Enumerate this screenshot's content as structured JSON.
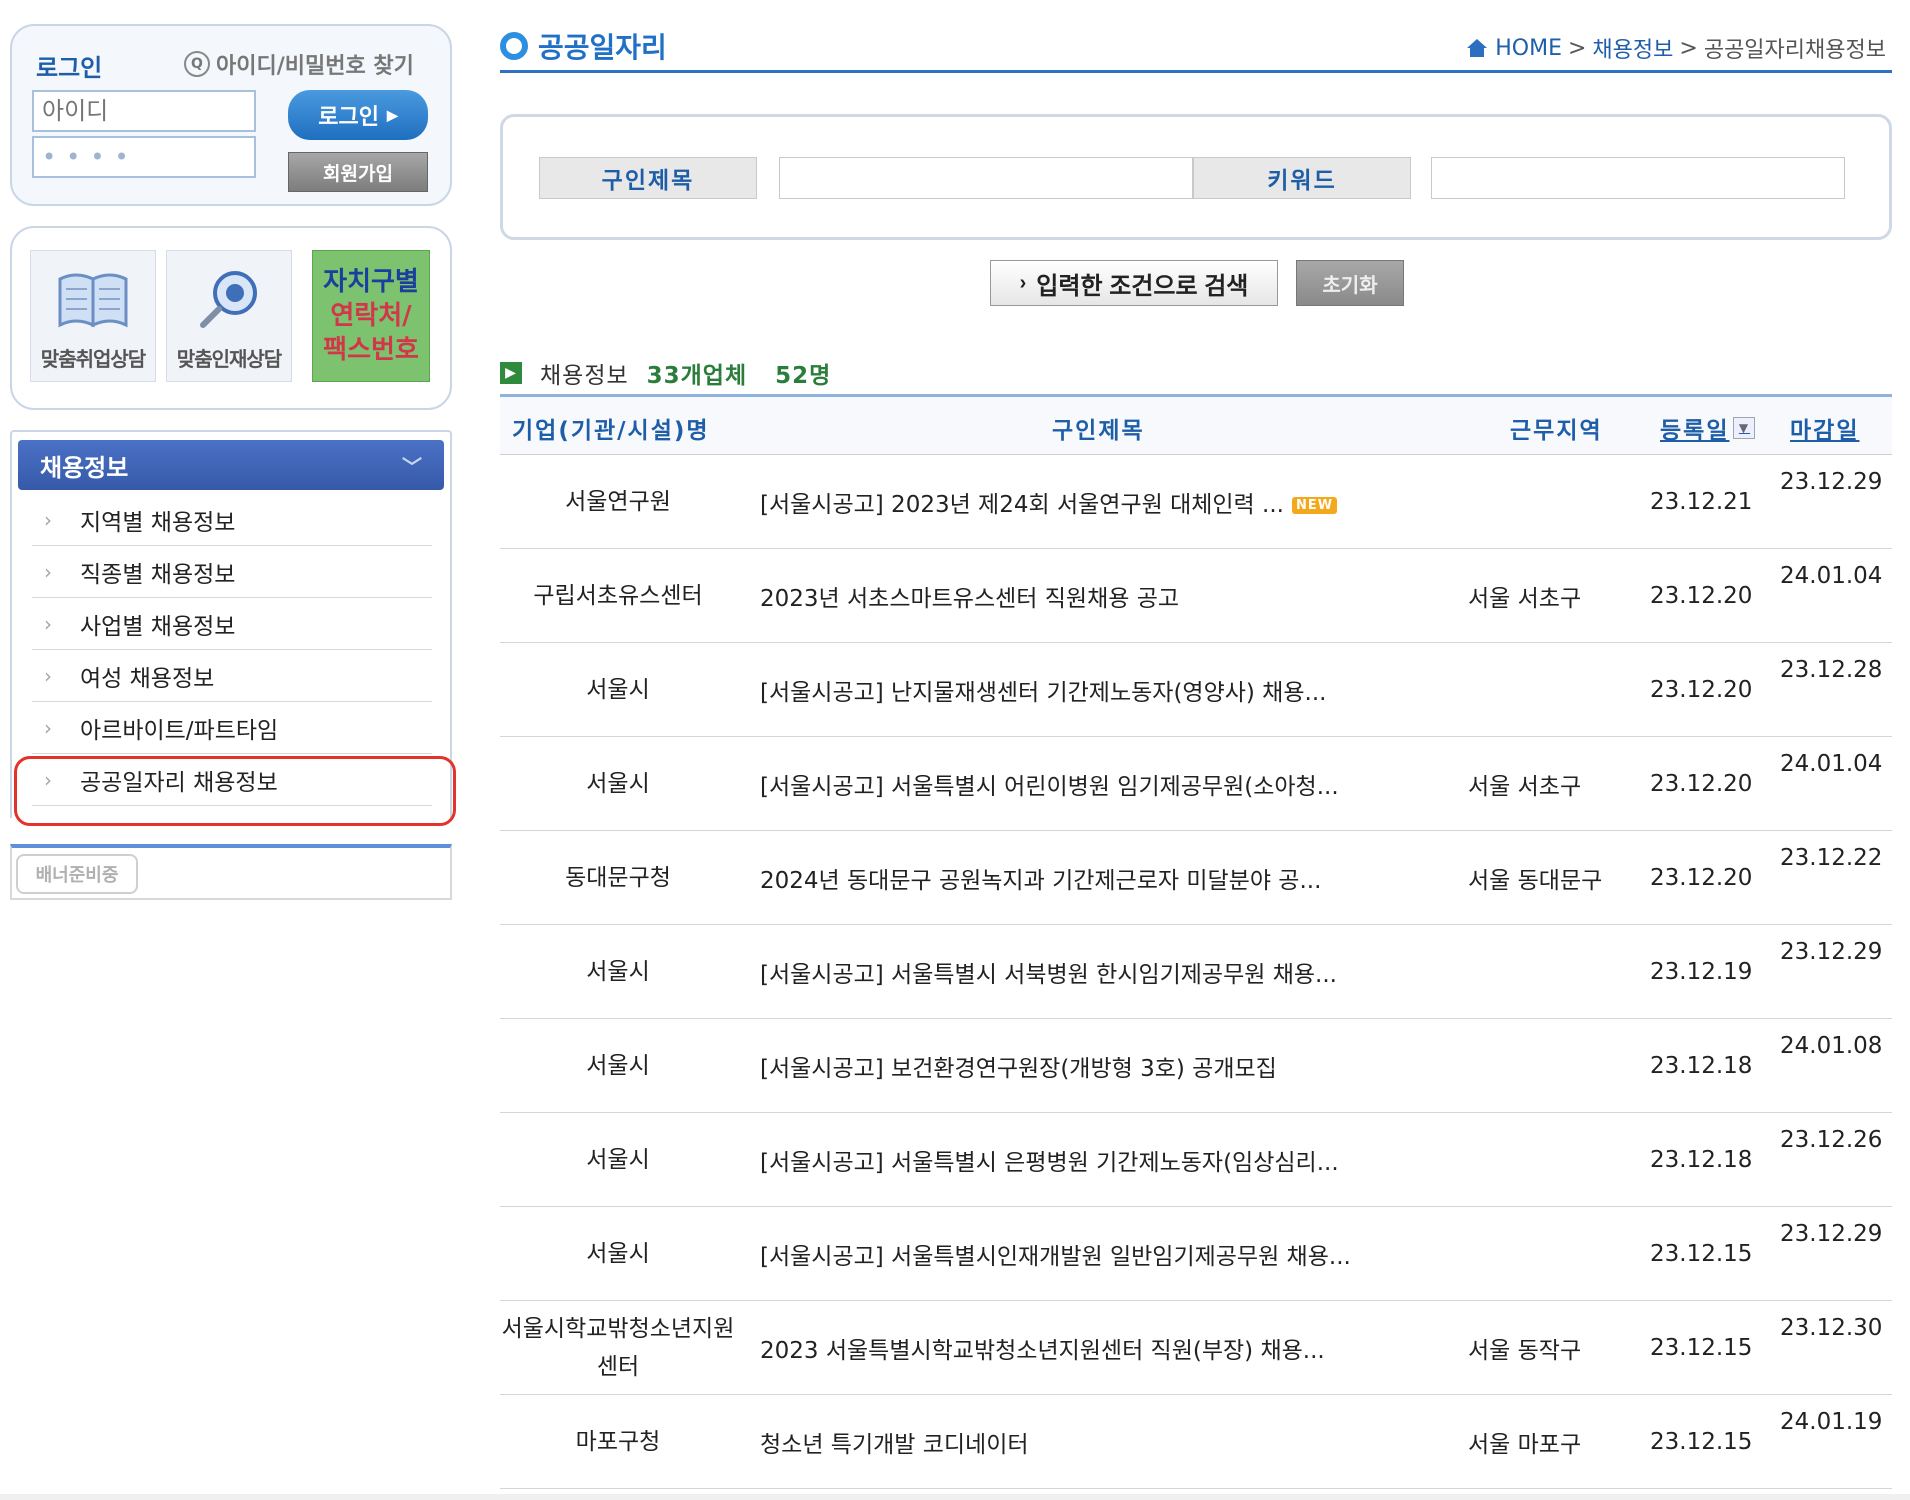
{
  "login": {
    "title": "로그인",
    "find_link": "아이디/비밀번호 찾기",
    "id_placeholder": "아이디",
    "password_mask": "••••",
    "login_button": "로그인",
    "join_button": "회원가입"
  },
  "quick_links": {
    "job_consult": "맞춤취업상담",
    "talent_consult": "맞춤인재상담",
    "district_contact": [
      "자치구별",
      "연락처/",
      "팩스번호"
    ]
  },
  "sidebar": {
    "header": "채용정보",
    "items": [
      {
        "label": "지역별 채용정보"
      },
      {
        "label": "직종별 채용정보"
      },
      {
        "label": "사업별 채용정보"
      },
      {
        "label": "여성 채용정보"
      },
      {
        "label": "아르바이트/파트타임"
      },
      {
        "label": "공공일자리 채용정보"
      }
    ],
    "banner_tab": "배너준비중"
  },
  "page": {
    "title": "공공일자리",
    "breadcrumb": [
      "HOME",
      "채용정보",
      "공공일자리채용정보"
    ]
  },
  "search": {
    "title_label": "구인제목",
    "keyword_label": "키워드",
    "title_value": "",
    "keyword_value": "",
    "search_button": "입력한 조건으로 검색",
    "reset_button": "초기화"
  },
  "summary": {
    "label": "채용정보",
    "company_count": "33개업체",
    "person_count": "52명"
  },
  "table": {
    "headers": {
      "org": "기업(기관/시설)명",
      "title": "구인제목",
      "region": "근무지역",
      "registered": "등록일",
      "deadline": "마감일"
    },
    "new_badge": "NEW",
    "rows": [
      {
        "org": "서울연구원",
        "title": "[서울시공고] 2023년 제24회 서울연구원 대체인력 ...",
        "region": "",
        "registered": "23.12.21",
        "deadline": "23.12.29",
        "is_new": true
      },
      {
        "org": "구립서초유스센터",
        "title": "2023년 서초스마트유스센터 직원채용 공고",
        "region": "서울 서초구",
        "registered": "23.12.20",
        "deadline": "24.01.04",
        "is_new": false
      },
      {
        "org": "서울시",
        "title": "[서울시공고] 난지물재생센터 기간제노동자(영양사) 채용...",
        "region": "",
        "registered": "23.12.20",
        "deadline": "23.12.28",
        "is_new": false
      },
      {
        "org": "서울시",
        "title": "[서울시공고] 서울특별시 어린이병원 임기제공무원(소아청...",
        "region": "서울 서초구",
        "registered": "23.12.20",
        "deadline": "24.01.04",
        "is_new": false
      },
      {
        "org": "동대문구청",
        "title": "2024년 동대문구 공원녹지과 기간제근로자 미달분야 공...",
        "region": "서울 동대문구",
        "registered": "23.12.20",
        "deadline": "23.12.22",
        "is_new": false
      },
      {
        "org": "서울시",
        "title": "[서울시공고] 서울특별시 서북병원 한시임기제공무원 채용...",
        "region": "",
        "registered": "23.12.19",
        "deadline": "23.12.29",
        "is_new": false
      },
      {
        "org": "서울시",
        "title": "[서울시공고] 보건환경연구원장(개방형 3호) 공개모집",
        "region": "",
        "registered": "23.12.18",
        "deadline": "24.01.08",
        "is_new": false
      },
      {
        "org": "서울시",
        "title": "[서울시공고] 서울특별시 은평병원 기간제노동자(임상심리...",
        "region": "",
        "registered": "23.12.18",
        "deadline": "23.12.26",
        "is_new": false
      },
      {
        "org": "서울시",
        "title": "[서울시공고] 서울특별시인재개발원 일반임기제공무원 채용...",
        "region": "",
        "registered": "23.12.15",
        "deadline": "23.12.29",
        "is_new": false
      },
      {
        "org": "서울시학교밖청소년지원센터",
        "title": "2023 서울특별시학교밖청소년지원센터 직원(부장) 채용...",
        "region": "서울 동작구",
        "registered": "23.12.15",
        "deadline": "23.12.30",
        "is_new": false
      },
      {
        "org": "마포구청",
        "title": "청소년 특기개발 코디네이터",
        "region": "서울 마포구",
        "registered": "23.12.15",
        "deadline": "24.01.19",
        "is_new": false
      }
    ]
  },
  "colors": {
    "accent_blue": "#1e5ea8",
    "title_blue": "#2070c8",
    "highlight_red": "#e3342b",
    "count_green": "#2a7d3a",
    "new_orange": "#f4a81c"
  }
}
